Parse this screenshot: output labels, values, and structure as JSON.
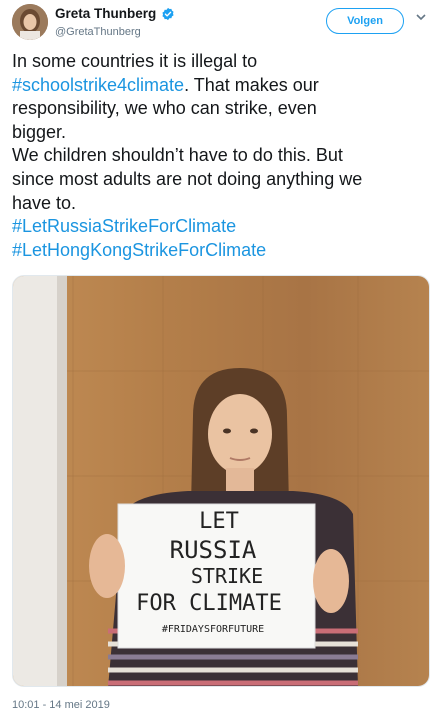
{
  "user": {
    "display_name": "Greta Thunberg",
    "handle": "@GretaThunberg",
    "verified": true,
    "verified_icon": "verified-badge-icon"
  },
  "follow_button": {
    "label": "Volgen"
  },
  "tweet": {
    "lines": [
      [
        {
          "text": "In some countries it is illegal to",
          "kind": "text"
        }
      ],
      [
        {
          "text": "#schoolstrike4climate",
          "kind": "hashtag"
        },
        {
          "text": ". That makes our",
          "kind": "text"
        }
      ],
      [
        {
          "text": "responsibility, we who can strike, even",
          "kind": "text"
        }
      ],
      [
        {
          "text": "bigger.",
          "kind": "text"
        }
      ],
      [
        {
          "text": "We children shouldn’t have to do this. But",
          "kind": "text"
        }
      ],
      [
        {
          "text": "since most adults are not doing anything we",
          "kind": "text"
        }
      ],
      [
        {
          "text": "have to.",
          "kind": "text"
        }
      ],
      [
        {
          "text": "#LetRussiaStrikeForClimate",
          "kind": "hashtag"
        }
      ],
      [
        {
          "text": "#LetHongKongStrikeForClimate",
          "kind": "hashtag"
        }
      ]
    ],
    "sign_text": [
      "LET",
      "RUSSIA",
      "STRIKE",
      "FOR CLIMATE",
      "#FRIDAYSFORFUTURE"
    ]
  },
  "timestamp": "10:01 - 14 mei 2019",
  "colors": {
    "accent": "#1da1f2",
    "hashtag": "#1b95e0",
    "muted": "#657786",
    "wall": "#b9844f"
  }
}
